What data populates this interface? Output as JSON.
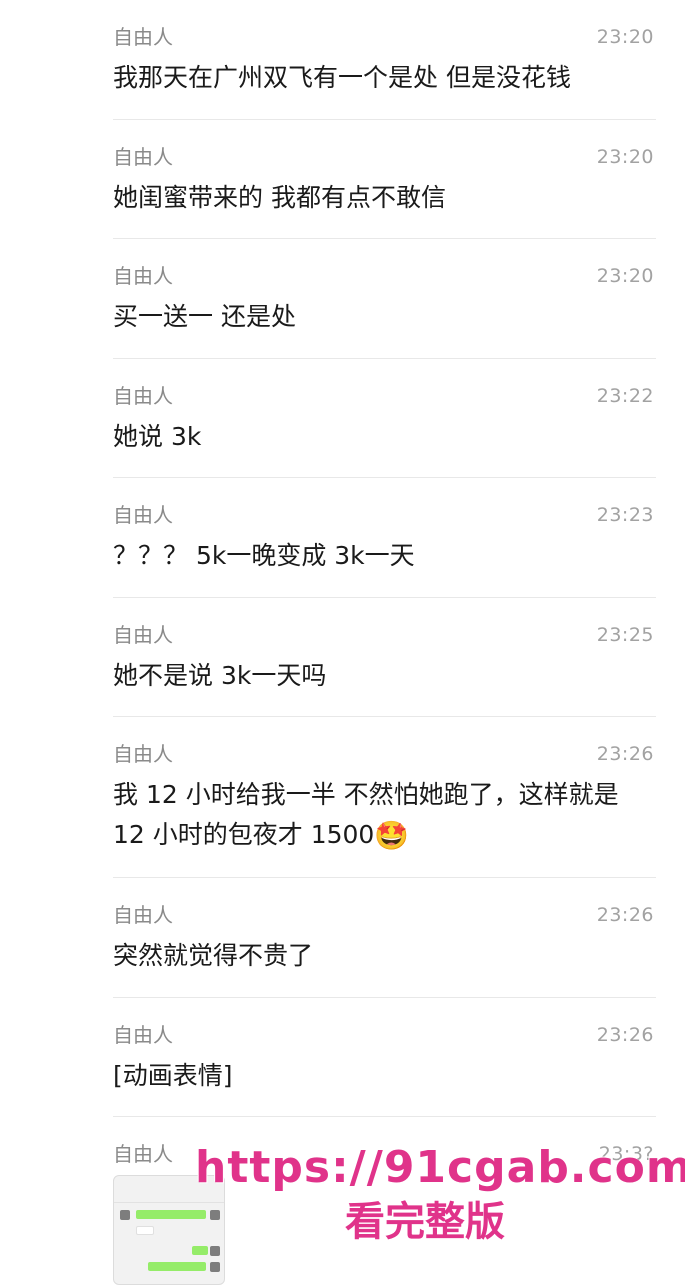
{
  "messages": [
    {
      "sender": "自由人",
      "time": "23:20",
      "text": "我那天在广州双飞有一个是处 但是没花钱"
    },
    {
      "sender": "自由人",
      "time": "23:20",
      "text": "她闺蜜带来的 我都有点不敢信"
    },
    {
      "sender": "自由人",
      "time": "23:20",
      "text": "买一送一 还是处"
    },
    {
      "sender": "自由人",
      "time": "23:22",
      "text": "她说 3k"
    },
    {
      "sender": "自由人",
      "time": "23:23",
      "text": "？？？ 5k一晚变成 3k一天"
    },
    {
      "sender": "自由人",
      "time": "23:25",
      "text": "她不是说 3k一天吗"
    },
    {
      "sender": "自由人",
      "time": "23:26",
      "text": "我 12 小时给我一半 不然怕她跑了，这样就是 12 小时的包夜才 1500",
      "emoji": "🤩"
    },
    {
      "sender": "自由人",
      "time": "23:26",
      "text": "突然就觉得不贵了"
    },
    {
      "sender": "自由人",
      "time": "23:26",
      "text": "[动画表情]"
    },
    {
      "sender": "自由人",
      "time": "23:3?",
      "image_thumbnail": "chat-screenshot-thumbnail"
    }
  ],
  "watermark": {
    "url": "https://91cgab.com",
    "subtitle": "看完整版",
    "color": "#e0338a"
  },
  "colors": {
    "sender": "#8a8a8a",
    "time": "#a2a2a2",
    "text": "#1a1a1a",
    "divider": "#e8e8e8",
    "bubble_green": "#95ec69"
  }
}
